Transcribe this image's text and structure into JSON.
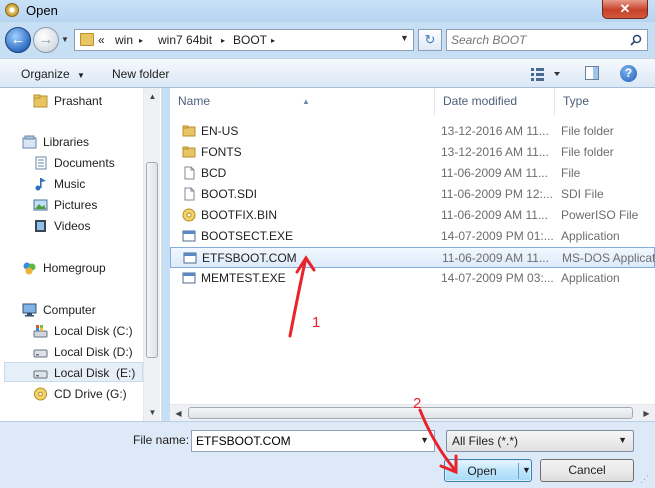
{
  "window": {
    "title": "Open",
    "close_label": "✕"
  },
  "navbar": {
    "back_glyph": "←",
    "forward_glyph": "→",
    "breadcrumb": {
      "root_chevron": "«",
      "segments": [
        "win",
        "win7 64bit",
        "BOOT"
      ],
      "separator": "▸"
    },
    "refresh_glyph": "↻",
    "search_placeholder": "Search BOOT"
  },
  "toolbar": {
    "organize_label": "Organize",
    "new_folder_label": "New folder",
    "help_label": "?"
  },
  "nav_pane": {
    "items": [
      {
        "label": "Prashant",
        "icon": "user-folder-icon"
      },
      {
        "label": "Libraries",
        "icon": "libraries-icon"
      },
      {
        "label": "Documents",
        "icon": "documents-icon"
      },
      {
        "label": "Music",
        "icon": "music-icon"
      },
      {
        "label": "Pictures",
        "icon": "pictures-icon"
      },
      {
        "label": "Videos",
        "icon": "videos-icon"
      },
      {
        "label": "Homegroup",
        "icon": "homegroup-icon"
      },
      {
        "label": "Computer",
        "icon": "computer-icon"
      },
      {
        "label": "Local Disk (C:)",
        "icon": "system-drive-icon"
      },
      {
        "label": "Local Disk (D:)",
        "icon": "drive-icon"
      },
      {
        "label": "Local Disk  (E:)",
        "icon": "drive-icon",
        "selected": true
      },
      {
        "label": "CD Drive (G:)",
        "icon": "cd-drive-icon"
      }
    ]
  },
  "file_list": {
    "columns": [
      "Name",
      "Date modified",
      "Type"
    ],
    "rows": [
      {
        "name": "EN-US",
        "date": "13-12-2016 AM 11...",
        "type": "File folder",
        "icon": "folder-icon"
      },
      {
        "name": "FONTS",
        "date": "13-12-2016 AM 11...",
        "type": "File folder",
        "icon": "folder-icon"
      },
      {
        "name": "BCD",
        "date": "11-06-2009 AM 11...",
        "type": "File",
        "icon": "file-icon"
      },
      {
        "name": "BOOT.SDI",
        "date": "11-06-2009 PM 12:...",
        "type": "SDI File",
        "icon": "file-icon"
      },
      {
        "name": "BOOTFIX.BIN",
        "date": "11-06-2009 AM 11...",
        "type": "PowerISO File",
        "icon": "poweriso-icon"
      },
      {
        "name": "BOOTSECT.EXE",
        "date": "14-07-2009 PM 01:...",
        "type": "Application",
        "icon": "application-icon"
      },
      {
        "name": "ETFSBOOT.COM",
        "date": "11-06-2009 AM 11...",
        "type": "MS-DOS Applicat",
        "icon": "msdos-app-icon",
        "selected": true
      },
      {
        "name": "MEMTEST.EXE",
        "date": "14-07-2009 PM 03:...",
        "type": "Application",
        "icon": "application-icon"
      }
    ]
  },
  "bottom": {
    "file_name_label": "File name:",
    "file_name_value": "ETFSBOOT.COM",
    "file_type_value": "All Files (*.*)",
    "open_label": "Open",
    "cancel_label": "Cancel"
  },
  "annotations": {
    "step1": "1",
    "step2": "2",
    "color": "#e8232a"
  }
}
